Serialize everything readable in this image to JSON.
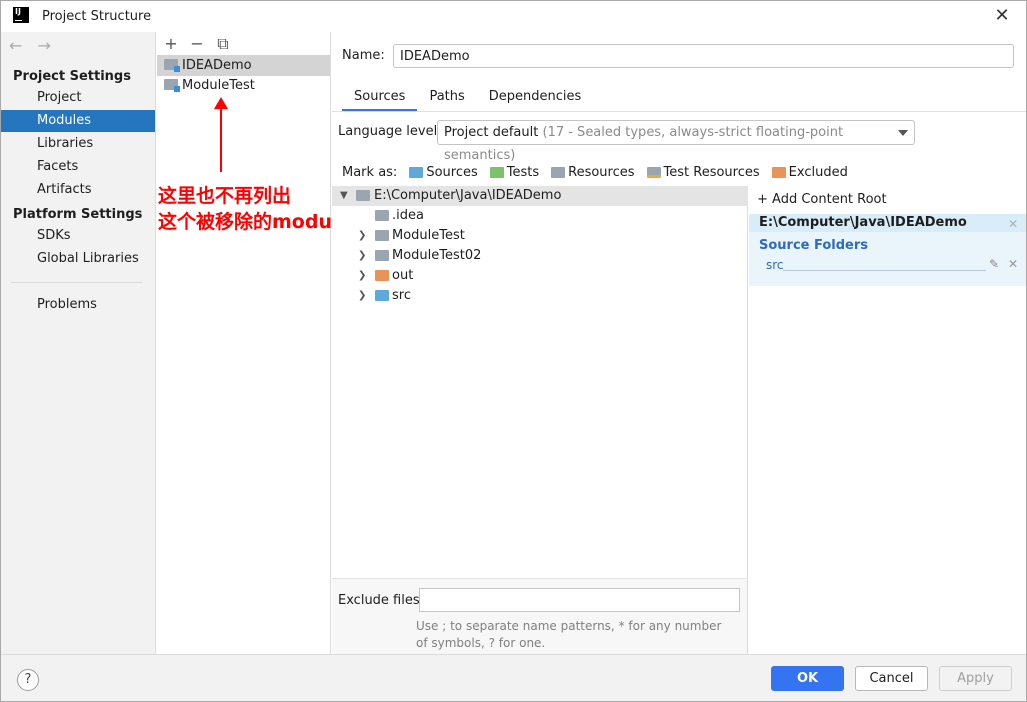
{
  "window": {
    "title": "Project Structure",
    "app_icon_text": "IJ"
  },
  "nav": {
    "back": "←",
    "forward": "→",
    "project_settings": "Project Settings",
    "items_project": [
      {
        "label": "Project"
      },
      {
        "label": "Modules",
        "selected": true
      },
      {
        "label": "Libraries"
      },
      {
        "label": "Facets"
      },
      {
        "label": "Artifacts"
      }
    ],
    "platform_settings": "Platform Settings",
    "items_platform": [
      {
        "label": "SDKs"
      },
      {
        "label": "Global Libraries"
      }
    ],
    "problems": "Problems"
  },
  "modules": {
    "toolbar": {
      "add": "+",
      "remove": "−",
      "copy": "⧉"
    },
    "list": [
      {
        "name": "IDEADemo",
        "selected": true
      },
      {
        "name": "ModuleTest"
      }
    ]
  },
  "annotation": {
    "line1": "这里也不再列出",
    "line2": "这个被移除的module",
    "color": "#ff0000"
  },
  "main": {
    "name_label": "Name:",
    "name_value": "IDEADemo",
    "tabs": [
      {
        "label": "Sources",
        "active": true
      },
      {
        "label": "Paths"
      },
      {
        "label": "Dependencies"
      }
    ],
    "language_level_label": "Language level:",
    "language_level_value": "Project default",
    "language_level_detail": " (17 - Sealed types, always-strict floating-point semantics)",
    "mark_as_label": "Mark as:",
    "mark_as": [
      {
        "label": "Sources",
        "color": "#5ea8db"
      },
      {
        "label": "Tests",
        "color": "#7cc26a"
      },
      {
        "label": "Resources",
        "color": "#9aa5b0"
      },
      {
        "label": "Test Resources",
        "color": "#9aa5b0"
      },
      {
        "label": "Excluded",
        "color": "#e8935a"
      }
    ],
    "tree": [
      {
        "label": "E:\\Computer\\Java\\IDEADemo",
        "expanded": true,
        "color": "#9aa5b0"
      },
      {
        "label": ".idea",
        "color": "#9aa5b0"
      },
      {
        "label": "ModuleTest",
        "color": "#9aa5b0"
      },
      {
        "label": "ModuleTest02",
        "color": "#9aa5b0"
      },
      {
        "label": "out",
        "color": "#e8935a"
      },
      {
        "label": "src",
        "color": "#5ea8db"
      }
    ],
    "exclude_label": "Exclude files:",
    "exclude_value": "",
    "exclude_hint": "Use ; to separate name patterns, * for any number of symbols, ? for one."
  },
  "content_root": {
    "add_label": "+ Add Content Root",
    "path": "E:\\Computer\\Java\\IDEADemo",
    "source_folders_label": "Source Folders",
    "source_folder": "src"
  },
  "footer": {
    "help": "?",
    "ok": "OK",
    "cancel": "Cancel",
    "apply": "Apply"
  }
}
